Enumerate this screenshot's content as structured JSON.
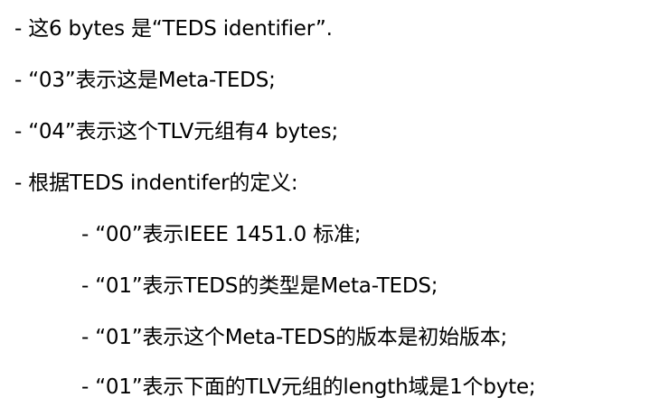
{
  "bullets": [
    {
      "text": "- 这6 bytes 是“TEDS identifier”."
    },
    {
      "text": "- “03”表示这是Meta-TEDS;"
    },
    {
      "text": "- “04”表示这个TLV元组有4 bytes;"
    },
    {
      "text": "- 根据TEDS indentifer的定义:"
    }
  ],
  "sub_bullets": [
    {
      "text": "- “00”表示IEEE 1451.0 标准;"
    },
    {
      "text": "- “01”表示TEDS的类型是Meta-TEDS;"
    },
    {
      "text": "- “01”表示这个Meta-TEDS的版本是初始版本;"
    },
    {
      "text": "- “01”表示下面的TLV元组的length域是1个byte;"
    }
  ]
}
